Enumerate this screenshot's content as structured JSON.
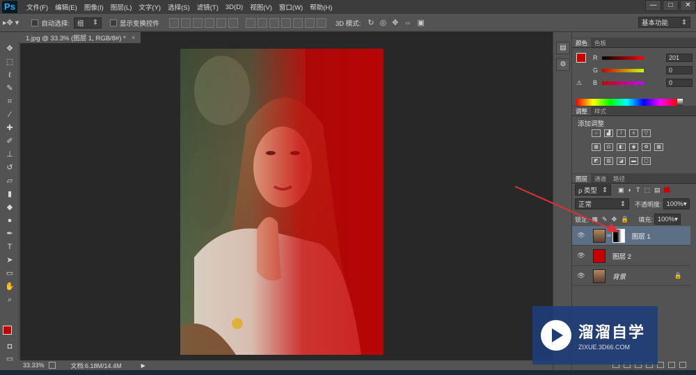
{
  "app": {
    "logo": "Ps",
    "menu": [
      "文件(F)",
      "编辑(E)",
      "图像(I)",
      "图层(L)",
      "文字(Y)",
      "选择(S)",
      "滤镜(T)",
      "3D(D)",
      "视图(V)",
      "窗口(W)",
      "帮助(H)"
    ],
    "window_controls": [
      "—",
      "□",
      "✕"
    ]
  },
  "options_bar": {
    "auto_select_label": "自动选择:",
    "auto_select_value": "组",
    "show_transform_label": "显示变换控件",
    "mode_3d_label": "3D 模式:",
    "workspace": "基本功能"
  },
  "document": {
    "tab_title": "1.jpg @ 33.3% (图层 1, RGB/8#) *",
    "tab_close": "×"
  },
  "status": {
    "zoom": "33.33%",
    "doc_info": "文档:6.18M/14.4M"
  },
  "panels": {
    "color_tabs": [
      "颜色",
      "色板"
    ],
    "color": {
      "r_label": "R",
      "r": "201",
      "g_label": "G",
      "g": "0",
      "b_label": "B",
      "b": "0",
      "foreground": "#c90000"
    },
    "adjust_tabs": [
      "调整",
      "样式"
    ],
    "adjust_title": "添加调整",
    "layers_tabs": [
      "图层",
      "通道",
      "路径"
    ],
    "layers": {
      "filter_label": "ρ 类型",
      "blend_mode": "正常",
      "opacity_label": "不透明度:",
      "opacity": "100%",
      "lock_label": "锁定:",
      "fill_label": "填充:",
      "fill": "100%",
      "items": [
        {
          "name": "图层 1",
          "selected": true
        },
        {
          "name": "图层 2",
          "selected": false
        },
        {
          "name": "背景",
          "selected": false
        }
      ]
    }
  },
  "watermark": {
    "name": "溜溜自学",
    "url": "ZIXUE.3D66.COM"
  },
  "colors": {
    "accent_red": "#c80000",
    "selection_blue": "#5c6f85",
    "annotation_arrow": "#e03030"
  }
}
